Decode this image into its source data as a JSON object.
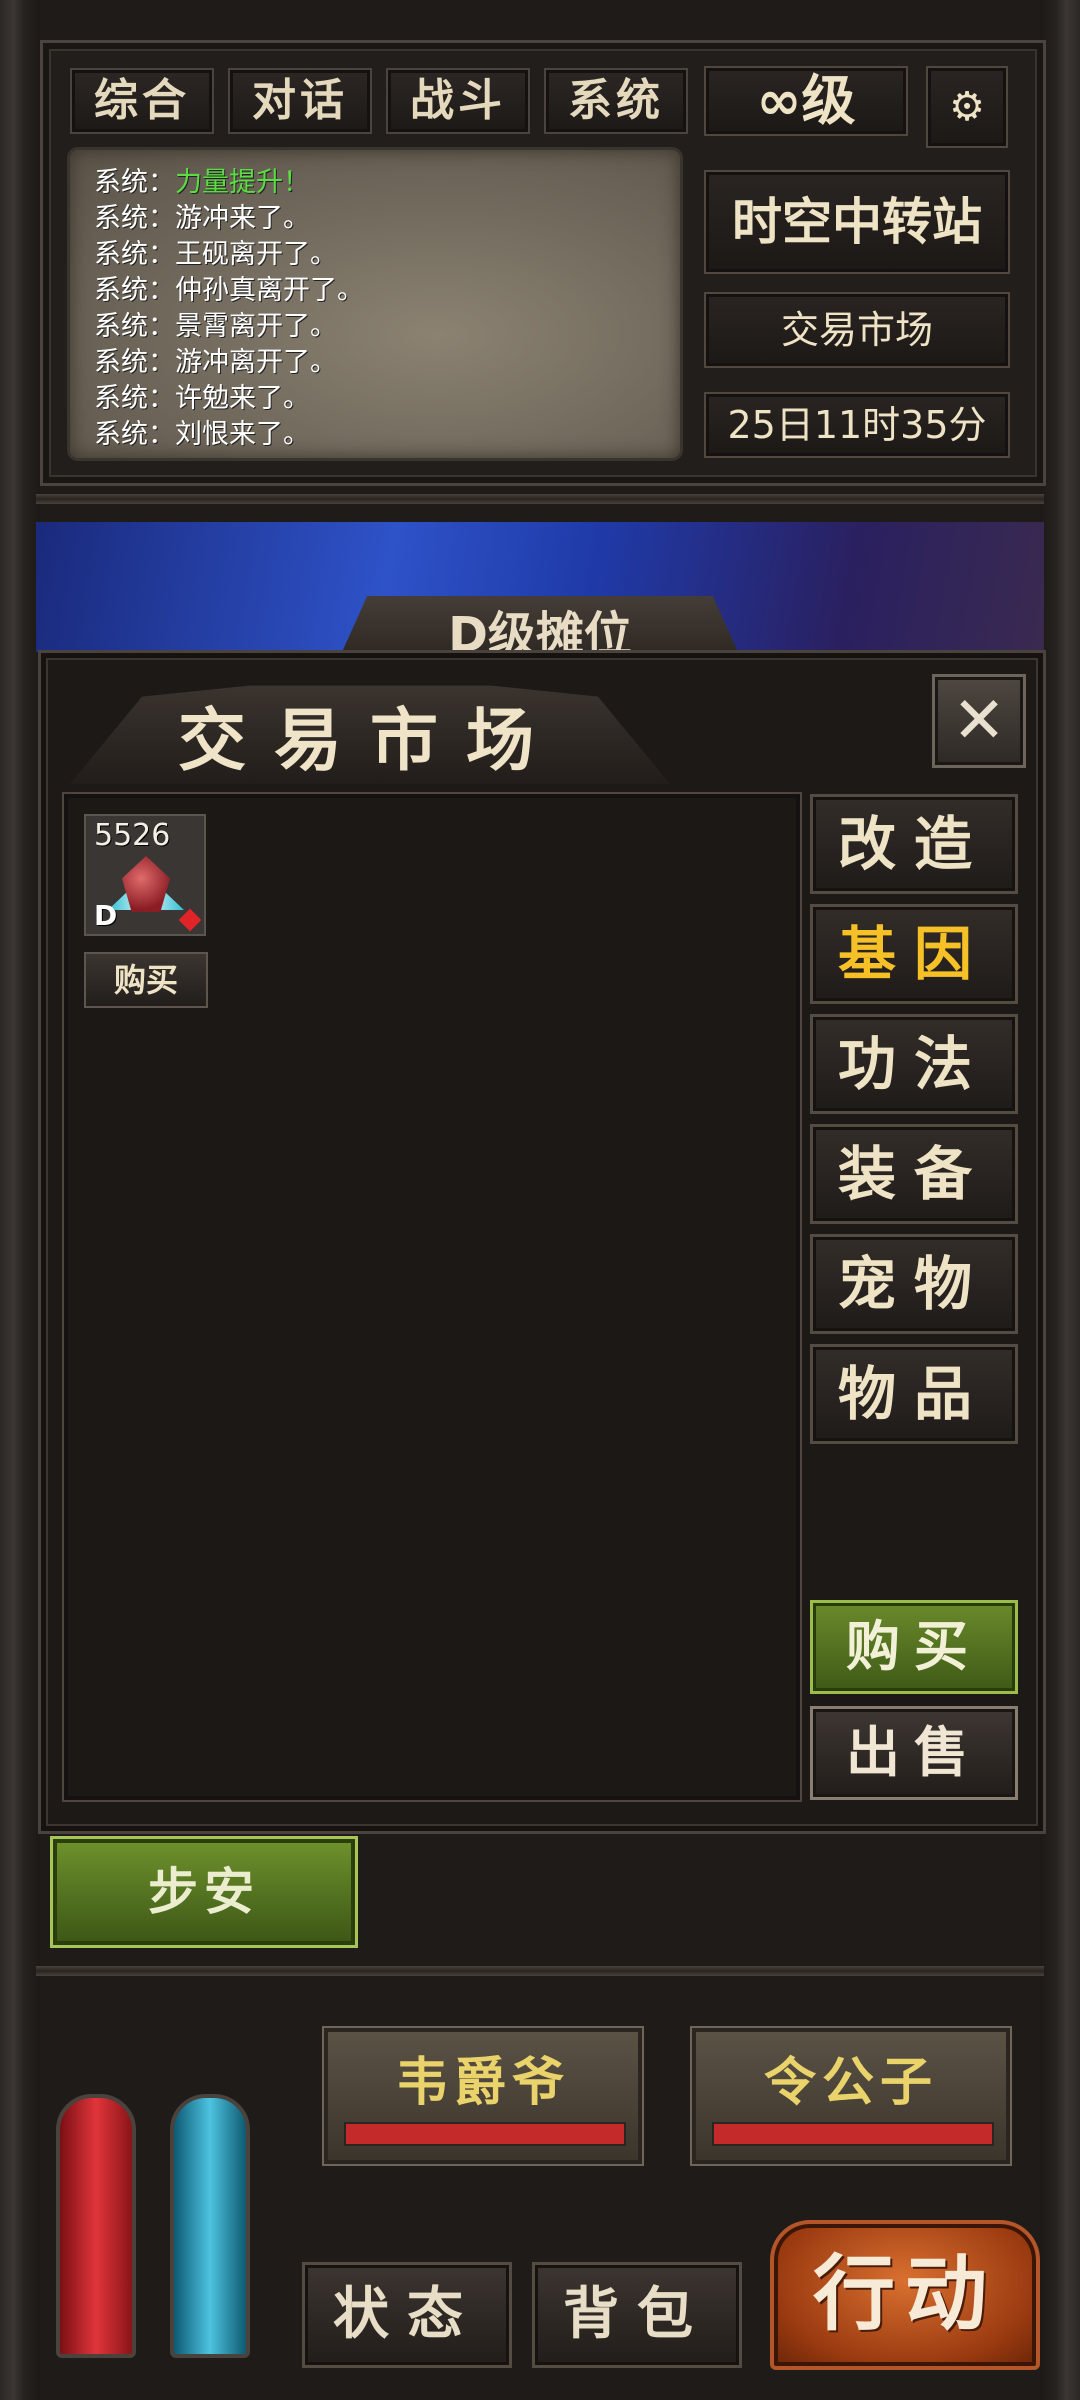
{
  "top": {
    "tabs": [
      "综合",
      "对话",
      "战斗",
      "系统"
    ],
    "level": "∞级",
    "location": "时空中转站",
    "sub_location": "交易市场",
    "time": "25日11时35分"
  },
  "chat": [
    {
      "prefix": "系统：",
      "text": "力量提升！",
      "highlight": true
    },
    {
      "prefix": "系统：",
      "text": "游冲来了。",
      "highlight": false
    },
    {
      "prefix": "系统：",
      "text": "王砚离开了。",
      "highlight": false
    },
    {
      "prefix": "系统：",
      "text": "仲孙真离开了。",
      "highlight": false
    },
    {
      "prefix": "系统：",
      "text": "景霄离开了。",
      "highlight": false
    },
    {
      "prefix": "系统：",
      "text": "游冲离开了。",
      "highlight": false
    },
    {
      "prefix": "系统：",
      "text": "许勉来了。",
      "highlight": false
    },
    {
      "prefix": "系统：",
      "text": "刘恨来了。",
      "highlight": false
    }
  ],
  "banner": {
    "title": "D级摊位"
  },
  "market": {
    "title": "交易市场",
    "close_label": "✕",
    "item": {
      "count": "5526",
      "grade": "D",
      "buy_label": "购买"
    },
    "categories": [
      "改造",
      "基因",
      "功法",
      "装备",
      "宠物",
      "物品"
    ],
    "active_category": "基因",
    "buy_label": "购买",
    "sell_label": "出售"
  },
  "player_button": "步安",
  "npcs": [
    "韦爵爷",
    "令公子"
  ],
  "bottom": {
    "status": "状态",
    "bag": "背包",
    "action": "行动"
  },
  "colors": {
    "highlight_green": "#5bdc43",
    "active_tab": "#f6c127",
    "hp": "#c42a2a",
    "mp": "#2aa6c8"
  }
}
